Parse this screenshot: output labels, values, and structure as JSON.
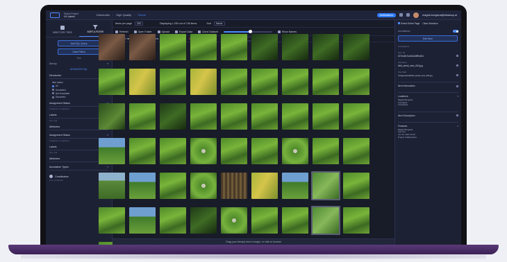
{
  "topbar": {
    "project_label": "Select Project",
    "project_value": "UX Labels",
    "crumbs": [
      "Directories",
      "High Quality",
      "Forms"
    ],
    "badge": "Notifications",
    "user": "magda.bongana@dataloop.ai"
  },
  "sidebar": {
    "tabs": [
      "DIRECTORY TREE",
      "SORT & FILTER"
    ],
    "buttons": [
      "Add DQL Query",
      "Clear Filters"
    ],
    "mode_label": "Tree",
    "query_label": "Sort by",
    "advanced_link": "ADVANCED DQL",
    "directories": "Directories",
    "item_status_label": "Item status",
    "status_options": [
      "All",
      "Annotated",
      "Not Annotated",
      "Discarded"
    ],
    "sections": [
      {
        "title": "Assignment Status",
        "sub": "Assigned, Completed"
      },
      {
        "title": "Labels",
        "sub": "Any, Cat"
      },
      {
        "title": "Attributes",
        "sub": ""
      },
      {
        "title": "Assignment Status",
        "sub": "Assigned, Completed"
      },
      {
        "title": "Labels",
        "sub": "Any, Cat"
      },
      {
        "title": "Attributes",
        "sub": ""
      },
      {
        "title": "Annotation Types",
        "sub": ""
      }
    ],
    "contributors": "Contributors",
    "contributors_sub": "Any contributor"
  },
  "main": {
    "items_per_page_label": "Items per page",
    "items_per_page": "250",
    "displaying": "Displaying 1-250 out of 746 items",
    "sort_label": "Sort",
    "sort_value": "Name",
    "tools": [
      "Refresh",
      "Open Folder",
      "Upload",
      "Export Data",
      "Clone Dataset",
      "Show Names"
    ],
    "selected": "Selected 1 item",
    "select_actions": [
      "Select Selected Items",
      "Move Selected Items"
    ],
    "delete_action": "Delete Selected Files",
    "search_placeholder": "Search items",
    "dropbar": "Drag your item(s) here to begin, or click to browse",
    "help": "?",
    "zoom": 0.55
  },
  "rpanel": {
    "top": [
      "Select Entire Page",
      "Clear Selection"
    ],
    "toggle_label": "Annotations",
    "button": "Edit Item",
    "fields": [
      {
        "label": "Annotations",
        "value": ""
      },
      {
        "label": "Item ID",
        "value": "6070a5b7a44b3a5ff9a0b1"
      },
      {
        "label": "Filename",
        "value": "field_aerial_view_054.jpg"
      },
      {
        "label": "File Path",
        "value": "/images/aerial/field_aerial_view_054.jpg"
      }
    ],
    "item_information": "Item Information",
    "sections": [
      "Locations",
      "Item Description",
      "Features"
    ],
    "meta_1": [
      "Magda Bongana",
      "Annotated",
      "Completed"
    ],
    "meta_2": [
      "Magda Bongana",
      "Summer",
      "Jun 22, 2021 11:00"
    ],
    "meta_3": "Project Collaborators"
  },
  "colors": {
    "accent": "#4d8cff",
    "background": "#1a1d2a",
    "laptop_base": "#4a2e66",
    "danger": "#ff4d4d"
  },
  "icons": {
    "logo": "dataloop-logo-icon",
    "help": "question-icon",
    "filter": "filter-icon",
    "tree": "tree-icon"
  },
  "thumbnails": [
    "rice-terrace-dark",
    "rice-terrace-dark",
    "green-field",
    "green-field",
    "green-field",
    "dark-field",
    "dark-field",
    "dark-field",
    "dark-field",
    "green-field",
    "yellow-field",
    "green-field",
    "yellow-field",
    "green-field",
    "green-field",
    "green-field",
    "green-field",
    "green-field",
    "forest-field",
    "green-field",
    "dark-field",
    "green-field",
    "green-field",
    "green-field",
    "green-field",
    "green-field",
    "green-field",
    "blue-sky-field",
    "green-field",
    "green-field",
    "river",
    "green-field",
    "green-field",
    "river",
    "green-field",
    "green-field",
    "hills",
    "blue-sky-field",
    "green-field",
    "river",
    "grid-field",
    "yellow-field",
    "blue-sky-field",
    "selected-path",
    "green-field",
    "green-field",
    "blue-sky-field",
    "green-field",
    "dark-field",
    "river",
    "green-field",
    "green-field",
    "selected-path",
    "green-field",
    "green-field",
    "green-field",
    "dark-field",
    "green-field",
    "green-field",
    "green-field",
    "green-field",
    "green-field",
    "green-field"
  ]
}
